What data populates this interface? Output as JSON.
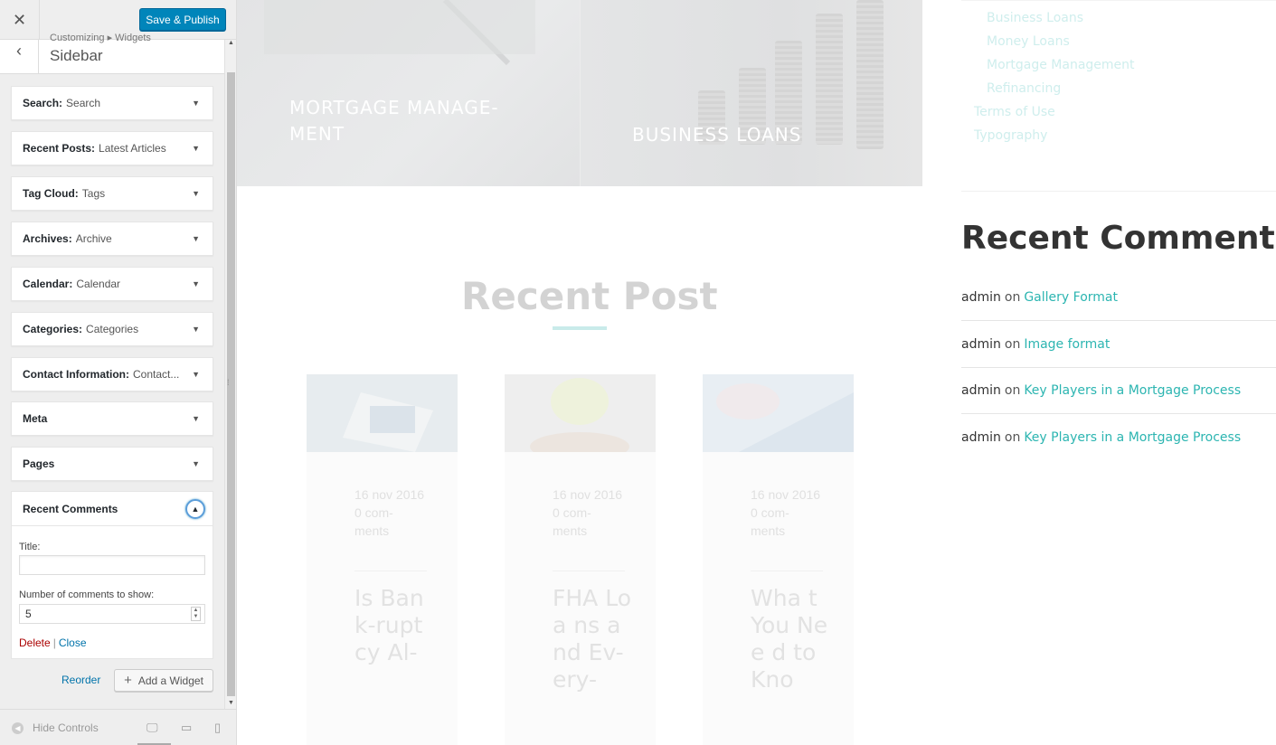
{
  "panel": {
    "close_icon": "close-icon",
    "save_label": "Save & Publish",
    "breadcrumb": "Customizing ▸ Widgets",
    "section_title": "Sidebar",
    "widgets": [
      {
        "name": "Search:",
        "title": "Search"
      },
      {
        "name": "Recent Posts:",
        "title": "Latest Articles"
      },
      {
        "name": "Tag Cloud:",
        "title": "Tags"
      },
      {
        "name": "Archives:",
        "title": "Archive"
      },
      {
        "name": "Calendar:",
        "title": "Calendar"
      },
      {
        "name": "Categories:",
        "title": "Categories"
      },
      {
        "name": "Contact Information:",
        "title": "Contact..."
      },
      {
        "name": "Meta",
        "title": ""
      },
      {
        "name": "Pages",
        "title": ""
      }
    ],
    "open_widget": {
      "name": "Recent Comments",
      "title_label": "Title:",
      "title_value": "",
      "count_label": "Number of comments to show:",
      "count_value": "5",
      "delete_label": "Delete",
      "separator": "|",
      "close_label": "Close"
    },
    "reorder_label": "Reorder",
    "add_widget_label": "Add a Widget",
    "hide_controls_label": "Hide Controls",
    "devices": [
      "desktop",
      "tablet",
      "mobile"
    ]
  },
  "preview": {
    "hero": [
      {
        "title": "MORTGAGE MANAGE-MENT"
      },
      {
        "title": "BUSINESS LOANS"
      }
    ],
    "recent_post_heading": "Recent Post",
    "posts": [
      {
        "date": "16 nov 2016",
        "comments": "0 com-ments",
        "title": "Is Ban k-rupt cy Al-"
      },
      {
        "date": "16 nov 2016",
        "comments": "0 com-ments",
        "title": "FHA Loa ns and Ev-ery-"
      },
      {
        "date": "16 nov 2016",
        "comments": "0 com-ments",
        "title": "Wha t You Nee d to Kno"
      }
    ],
    "pages": [
      {
        "label": "Business Loans"
      },
      {
        "label": "Money Loans"
      },
      {
        "label": "Mortgage Management"
      },
      {
        "label": "Refinancing"
      },
      {
        "label": "Terms of Use"
      },
      {
        "label": "Typography"
      }
    ],
    "recent_comments_heading": "Recent Comments",
    "comments": [
      {
        "author": "admin",
        "on": "on",
        "post": "Gallery Format"
      },
      {
        "author": "admin",
        "on": "on",
        "post": "Image format"
      },
      {
        "author": "admin",
        "on": "on",
        "post": "Key Players in a Mortgage Process"
      },
      {
        "author": "admin",
        "on": "on",
        "post": "Key Players in a Mortgage Process"
      }
    ],
    "accent_color": "#2cb5b1"
  }
}
